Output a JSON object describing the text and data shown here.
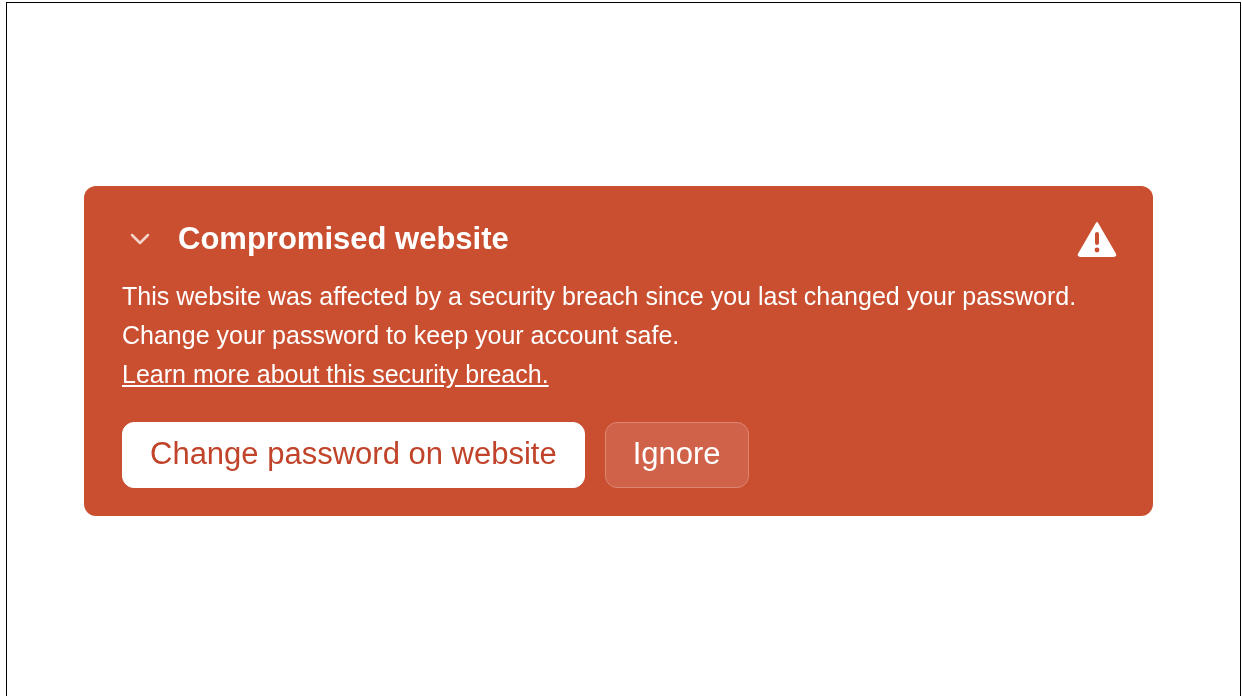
{
  "alert": {
    "title": "Compromised website",
    "expanded": true,
    "message": "This website was affected by a security breach since you last changed your password. Change your password to keep your account safe.",
    "link": "Learn more about this security breach.",
    "buttons": [
      {
        "label": "Change password on website",
        "kind": "primary"
      },
      {
        "label": "Ignore",
        "kind": "secondary"
      }
    ]
  }
}
